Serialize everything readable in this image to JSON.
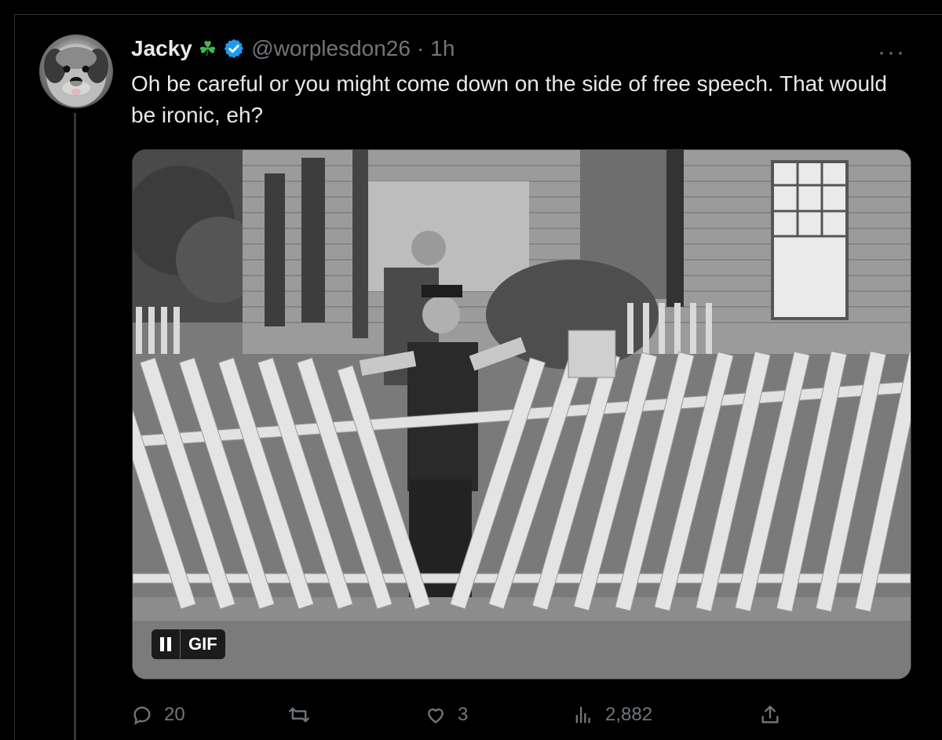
{
  "tweet": {
    "author_name": "Jacky",
    "author_emoji": "☘",
    "handle": "@worplesdon26",
    "separator": "·",
    "time": "1h",
    "more": "···",
    "text": "Oh be careful or you might come down on the side of free speech. That would be ironic, eh?"
  },
  "media": {
    "badge_label": "GIF"
  },
  "actions": {
    "replies": "20",
    "reposts": "",
    "likes": "3",
    "views": "2,882"
  },
  "icons": {
    "reply": "reply-icon",
    "repost": "repost-icon",
    "like": "heart-icon",
    "views": "views-icon",
    "share": "share-icon",
    "verified": "verified-badge-icon",
    "pause": "pause-icon"
  },
  "colors": {
    "background": "#000000",
    "text": "#e7e9ea",
    "muted": "#71767b",
    "verified": "#1d9bf0",
    "clover": "#3fb950"
  }
}
